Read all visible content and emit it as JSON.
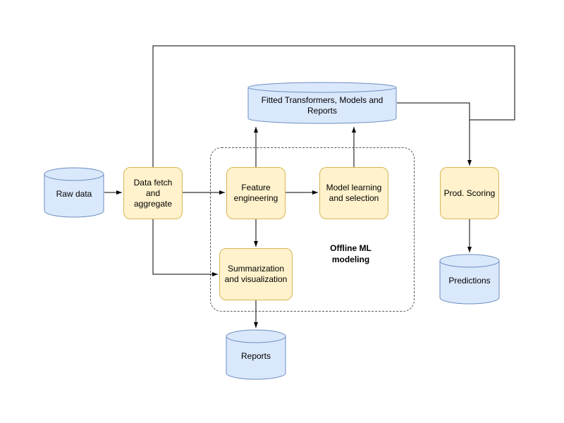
{
  "nodes": {
    "raw_data": {
      "label": "Raw data"
    },
    "data_fetch": {
      "label": "Data fetch and aggregate"
    },
    "feature_eng": {
      "label": "Feature engineering"
    },
    "model_learn": {
      "label": "Model learning and selection"
    },
    "summarization": {
      "label": "Summarization and visualization"
    },
    "fitted_store": {
      "label": "Fitted Transformers, Models and Reports"
    },
    "prod_scoring": {
      "label": "Prod. Scoring"
    },
    "predictions": {
      "label": "Predictions"
    },
    "reports": {
      "label": "Reports"
    }
  },
  "group": {
    "label": "Offline ML modeling"
  },
  "colors": {
    "process_fill": "#fff2cc",
    "process_stroke": "#d6b656",
    "db_fill": "#dae8fc",
    "db_stroke": "#6c8ebf",
    "arrow": "#000000"
  }
}
